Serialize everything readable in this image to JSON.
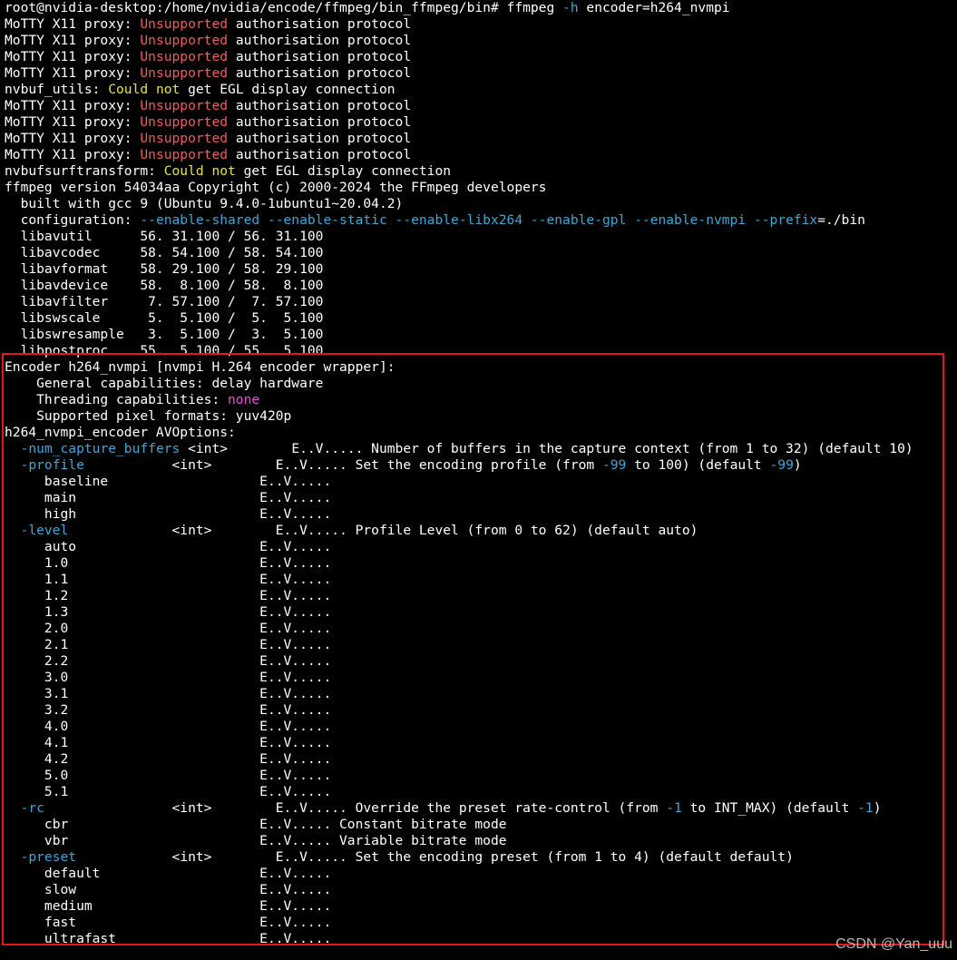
{
  "colors": {
    "default": "#ffffff",
    "red": "#ee5b5b",
    "yellow": "#e6e63a",
    "cyan": "#39a9d8",
    "magenta": "#e84fd8",
    "highlight_border": "#e8141c"
  },
  "watermark": "CSDN @Yan_uuu",
  "lines": [
    [
      {
        "t": "root@nvidia-desktop:/home/nvidia/encode/ffmpeg/bin_ffmpeg/bin# ffmpeg "
      },
      {
        "t": "-h",
        "c": "cyan"
      },
      {
        "t": " encoder=h264_nvmpi"
      }
    ],
    [
      {
        "t": "MoTTY X11 proxy: "
      },
      {
        "t": "Unsupported",
        "c": "red"
      },
      {
        "t": " authorisation protocol"
      }
    ],
    [
      {
        "t": "MoTTY X11 proxy: "
      },
      {
        "t": "Unsupported",
        "c": "red"
      },
      {
        "t": " authorisation protocol"
      }
    ],
    [
      {
        "t": "MoTTY X11 proxy: "
      },
      {
        "t": "Unsupported",
        "c": "red"
      },
      {
        "t": " authorisation protocol"
      }
    ],
    [
      {
        "t": "MoTTY X11 proxy: "
      },
      {
        "t": "Unsupported",
        "c": "red"
      },
      {
        "t": " authorisation protocol"
      }
    ],
    [
      {
        "t": "nvbuf_utils: "
      },
      {
        "t": "Could not",
        "c": "yellow"
      },
      {
        "t": " get EGL display connection"
      }
    ],
    [
      {
        "t": "MoTTY X11 proxy: "
      },
      {
        "t": "Unsupported",
        "c": "red"
      },
      {
        "t": " authorisation protocol"
      }
    ],
    [
      {
        "t": "MoTTY X11 proxy: "
      },
      {
        "t": "Unsupported",
        "c": "red"
      },
      {
        "t": " authorisation protocol"
      }
    ],
    [
      {
        "t": "MoTTY X11 proxy: "
      },
      {
        "t": "Unsupported",
        "c": "red"
      },
      {
        "t": " authorisation protocol"
      }
    ],
    [
      {
        "t": "MoTTY X11 proxy: "
      },
      {
        "t": "Unsupported",
        "c": "red"
      },
      {
        "t": " authorisation protocol"
      }
    ],
    [
      {
        "t": "nvbufsurftransform: "
      },
      {
        "t": "Could not",
        "c": "yellow"
      },
      {
        "t": " get EGL display connection"
      }
    ],
    [
      {
        "t": "ffmpeg version 54034aa Copyright (c) 2000-2024 the FFmpeg developers"
      }
    ],
    [
      {
        "t": "  built with gcc 9 (Ubuntu 9.4.0-1ubuntu1~20.04.2)"
      }
    ],
    [
      {
        "t": "  configuration: "
      },
      {
        "t": "--enable-shared --enable-static --enable-libx264 --enable-gpl --enable-nvmpi --prefix",
        "c": "cyan"
      },
      {
        "t": "=./bin"
      }
    ],
    [
      {
        "t": "  libavutil      56. 31.100 / 56. 31.100"
      }
    ],
    [
      {
        "t": "  libavcodec     58. 54.100 / 58. 54.100"
      }
    ],
    [
      {
        "t": "  libavformat    58. 29.100 / 58. 29.100"
      }
    ],
    [
      {
        "t": "  libavdevice    58.  8.100 / 58.  8.100"
      }
    ],
    [
      {
        "t": "  libavfilter     7. 57.100 /  7. 57.100"
      }
    ],
    [
      {
        "t": "  libswscale      5.  5.100 /  5.  5.100"
      }
    ],
    [
      {
        "t": "  libswresample   3.  5.100 /  3.  5.100"
      }
    ],
    [
      {
        "t": "  libpostproc    55.  5.100 / 55.  5.100"
      }
    ],
    [
      {
        "t": "Encoder h264_nvmpi [nvmpi H.264 encoder wrapper]:"
      }
    ],
    [
      {
        "t": "    General capabilities: delay hardware"
      }
    ],
    [
      {
        "t": "    Threading capabilities: "
      },
      {
        "t": "none",
        "c": "magenta"
      }
    ],
    [
      {
        "t": "    Supported pixel formats: yuv420p"
      }
    ],
    [
      {
        "t": "h264_nvmpi_encoder AVOptions:"
      }
    ],
    [
      {
        "t": "  "
      },
      {
        "t": "-num_capture_buffers",
        "c": "cyan"
      },
      {
        "t": " <int>        E..V..... Number of buffers in the capture context (from 1 to 32) (default 10)"
      }
    ],
    [
      {
        "t": "  "
      },
      {
        "t": "-profile",
        "c": "cyan"
      },
      {
        "t": "           <int>        E..V..... Set the encoding profile (from "
      },
      {
        "t": "-99",
        "c": "cyan"
      },
      {
        "t": " to 100) (default "
      },
      {
        "t": "-99",
        "c": "cyan"
      },
      {
        "t": ")"
      }
    ],
    [
      {
        "t": "     baseline                   E..V....."
      }
    ],
    [
      {
        "t": "     main                       E..V....."
      }
    ],
    [
      {
        "t": "     high                       E..V....."
      }
    ],
    [
      {
        "t": "  "
      },
      {
        "t": "-level",
        "c": "cyan"
      },
      {
        "t": "             <int>        E..V..... Profile Level (from 0 to 62) (default auto)"
      }
    ],
    [
      {
        "t": "     auto                       E..V....."
      }
    ],
    [
      {
        "t": "     1.0                        E..V....."
      }
    ],
    [
      {
        "t": "     1.1                        E..V....."
      }
    ],
    [
      {
        "t": "     1.2                        E..V....."
      }
    ],
    [
      {
        "t": "     1.3                        E..V....."
      }
    ],
    [
      {
        "t": "     2.0                        E..V....."
      }
    ],
    [
      {
        "t": "     2.1                        E..V....."
      }
    ],
    [
      {
        "t": "     2.2                        E..V....."
      }
    ],
    [
      {
        "t": "     3.0                        E..V....."
      }
    ],
    [
      {
        "t": "     3.1                        E..V....."
      }
    ],
    [
      {
        "t": "     3.2                        E..V....."
      }
    ],
    [
      {
        "t": "     4.0                        E..V....."
      }
    ],
    [
      {
        "t": "     4.1                        E..V....."
      }
    ],
    [
      {
        "t": "     4.2                        E..V....."
      }
    ],
    [
      {
        "t": "     5.0                        E..V....."
      }
    ],
    [
      {
        "t": "     5.1                        E..V....."
      }
    ],
    [
      {
        "t": "  "
      },
      {
        "t": "-rc",
        "c": "cyan"
      },
      {
        "t": "                <int>        E..V..... Override the preset rate-control (from "
      },
      {
        "t": "-1",
        "c": "cyan"
      },
      {
        "t": " to INT_MAX) (default "
      },
      {
        "t": "-1",
        "c": "cyan"
      },
      {
        "t": ")"
      }
    ],
    [
      {
        "t": "     cbr                        E..V..... Constant bitrate mode"
      }
    ],
    [
      {
        "t": "     vbr                        E..V..... Variable bitrate mode"
      }
    ],
    [
      {
        "t": "  "
      },
      {
        "t": "-preset",
        "c": "cyan"
      },
      {
        "t": "            <int>        E..V..... Set the encoding preset (from 1 to 4) (default default)"
      }
    ],
    [
      {
        "t": "     default                    E..V....."
      }
    ],
    [
      {
        "t": "     slow                       E..V....."
      }
    ],
    [
      {
        "t": "     medium                     E..V....."
      }
    ],
    [
      {
        "t": "     fast                       E..V....."
      }
    ],
    [
      {
        "t": "     ultrafast                  E..V....."
      }
    ]
  ]
}
